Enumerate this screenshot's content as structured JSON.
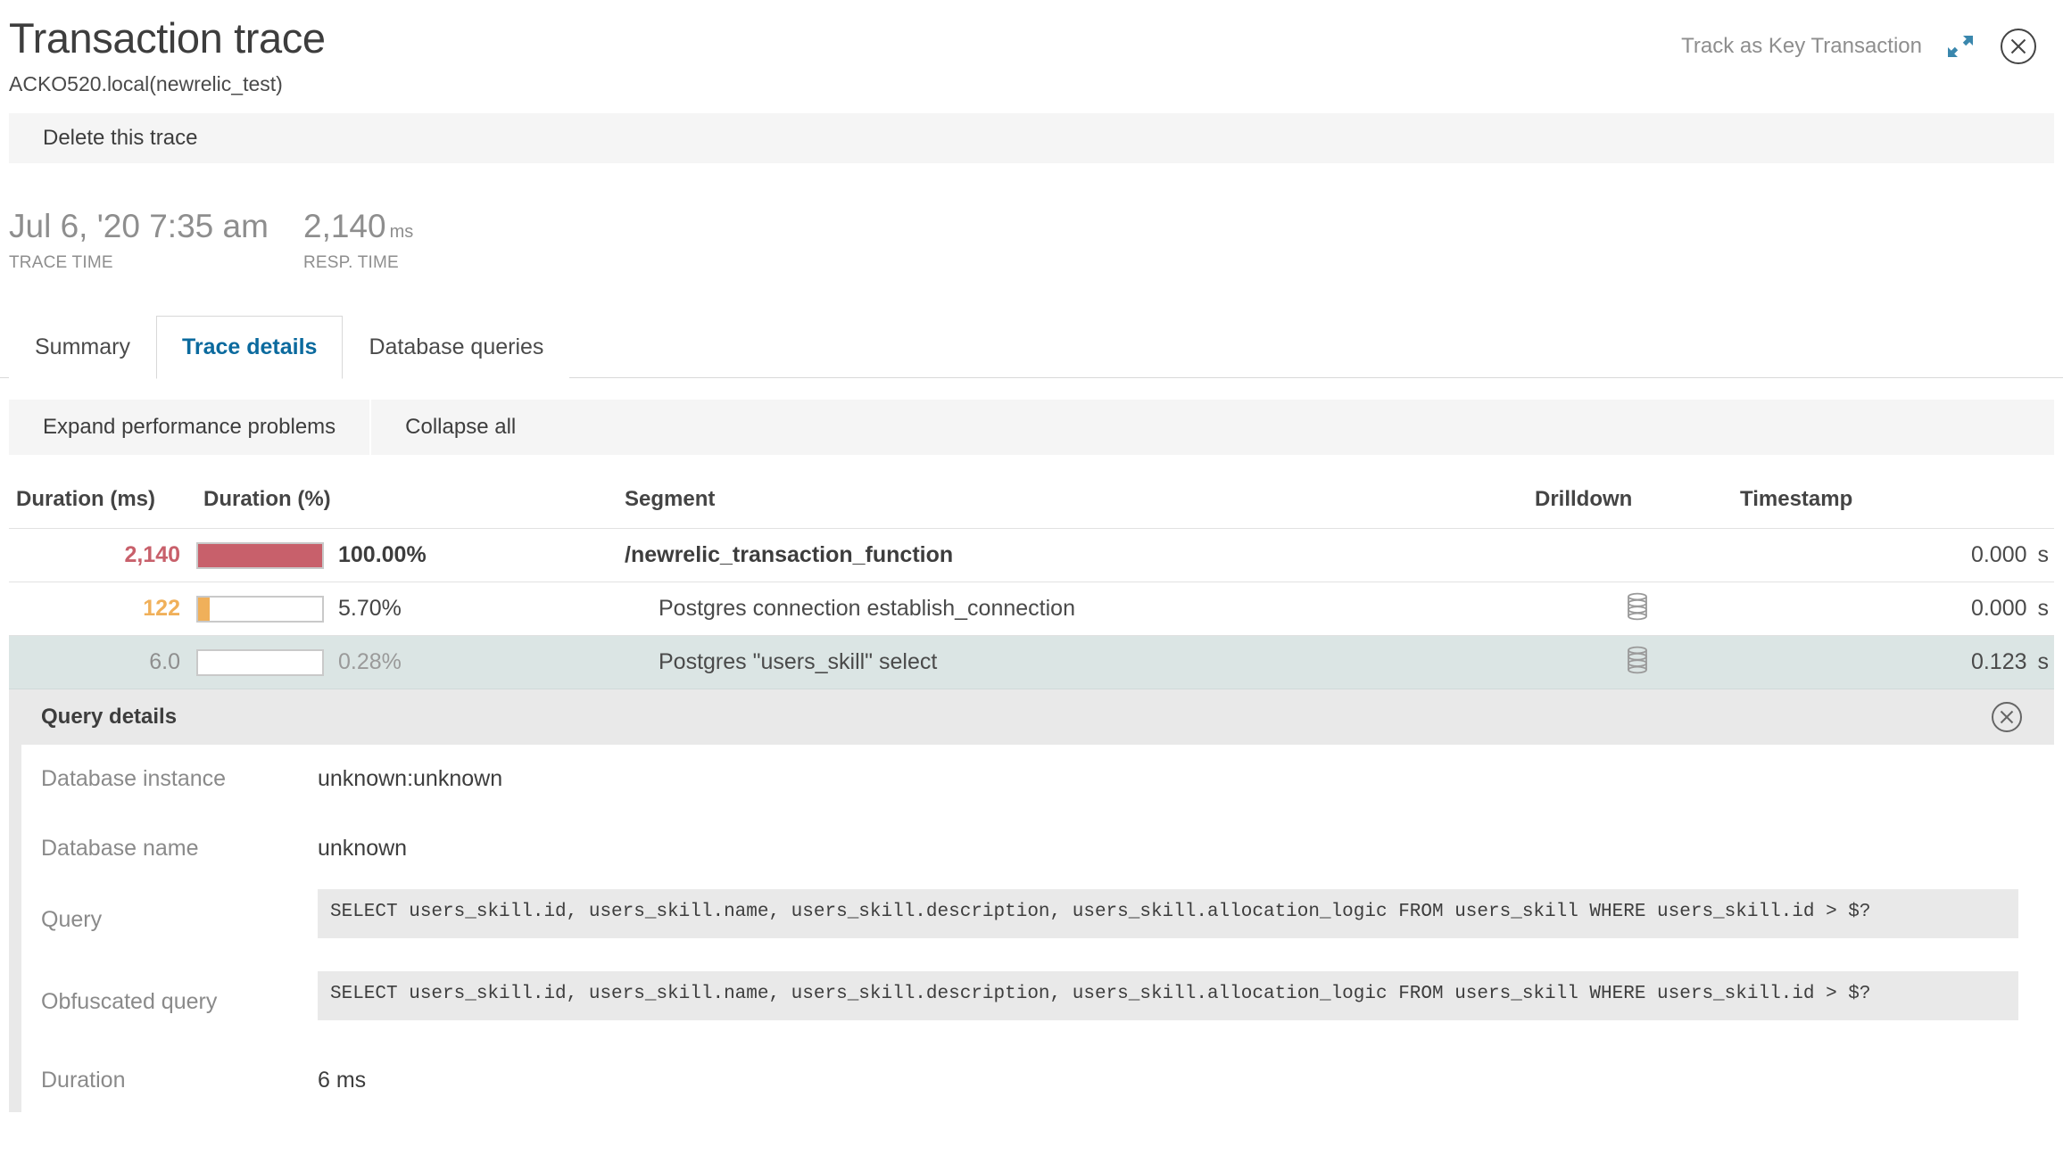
{
  "header": {
    "title": "Transaction trace",
    "subtitle": "ACKO520.local(newrelic_test)",
    "track_key_label": "Track as Key Transaction",
    "expand_icon": "expand-arrows-icon",
    "close_icon": "close-circle-icon"
  },
  "delete_bar": {
    "label": "Delete this trace"
  },
  "stats": [
    {
      "value": "Jul 6, '20 7:35 am",
      "unit": "",
      "label": "TRACE TIME"
    },
    {
      "value": "2,140",
      "unit": "ms",
      "label": "RESP. TIME"
    }
  ],
  "tabs": [
    {
      "label": "Summary",
      "active": false
    },
    {
      "label": "Trace details",
      "active": true
    },
    {
      "label": "Database queries",
      "active": false
    }
  ],
  "toolbar": {
    "expand_label": "Expand performance problems",
    "collapse_label": "Collapse all"
  },
  "table": {
    "columns": {
      "duration_ms": "Duration (ms)",
      "duration_pct": "Duration (%)",
      "segment": "Segment",
      "drilldown": "Drilldown",
      "timestamp": "Timestamp"
    },
    "rows": [
      {
        "duration_ms": "2,140",
        "duration_pct_label": "100.00%",
        "duration_pct_value": 100.0,
        "segment": "/newrelic_transaction_function",
        "drilldown_icon": "",
        "timestamp": "0.000",
        "timestamp_unit": "s"
      },
      {
        "duration_ms": "122",
        "duration_pct_label": "5.70%",
        "duration_pct_value": 5.7,
        "segment": "Postgres connection establish_connection",
        "drilldown_icon": "database-icon",
        "timestamp": "0.000",
        "timestamp_unit": "s"
      },
      {
        "duration_ms": "6.0",
        "duration_pct_label": "0.28%",
        "duration_pct_value": 0.28,
        "segment": "Postgres \"users_skill\" select",
        "drilldown_icon": "database-icon",
        "timestamp": "0.123",
        "timestamp_unit": "s"
      }
    ]
  },
  "query_panel": {
    "title": "Query details",
    "close_icon": "close-circle-icon",
    "rows": [
      {
        "label": "Database instance",
        "value": "unknown:unknown"
      },
      {
        "label": "Database name",
        "value": "unknown"
      },
      {
        "label": "Query",
        "value": "SELECT users_skill.id, users_skill.name, users_skill.description, users_skill.allocation_logic FROM users_skill WHERE users_skill.id > $?"
      },
      {
        "label": "Obfuscated query",
        "value": "SELECT users_skill.id, users_skill.name, users_skill.description, users_skill.allocation_logic FROM users_skill WHERE users_skill.id > $?"
      },
      {
        "label": "Duration",
        "value": "6 ms"
      }
    ]
  },
  "colors": {
    "critical": "#c8606b",
    "warning": "#f0b05a",
    "accent": "#0b6a9e",
    "selected_row": "#dbe5e4",
    "panel_header": "#e9e9e9"
  }
}
